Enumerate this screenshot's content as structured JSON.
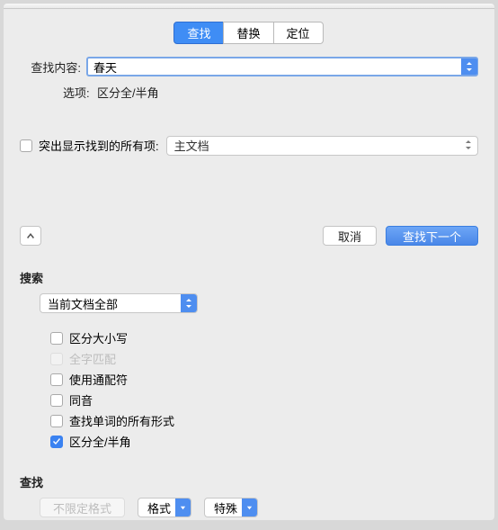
{
  "tabs": {
    "find": "查找",
    "replace": "替换",
    "goto": "定位"
  },
  "find": {
    "label": "查找内容:",
    "value": "春天",
    "options_label": "选项:",
    "options_value": "区分全/半角"
  },
  "highlight": {
    "label": "突出显示找到的所有项:",
    "select_value": "主文档"
  },
  "buttons": {
    "cancel": "取消",
    "find_next": "查找下一个"
  },
  "search_section": {
    "title": "搜索",
    "scope_value": "当前文档全部",
    "match_case": "区分大小写",
    "whole_word": "全字匹配",
    "wildcards": "使用通配符",
    "homophone": "同音",
    "all_forms": "查找单词的所有形式",
    "fullwidth": "区分全/半角"
  },
  "find_section": {
    "title": "查找",
    "no_format": "不限定格式",
    "format": "格式",
    "special": "特殊"
  }
}
